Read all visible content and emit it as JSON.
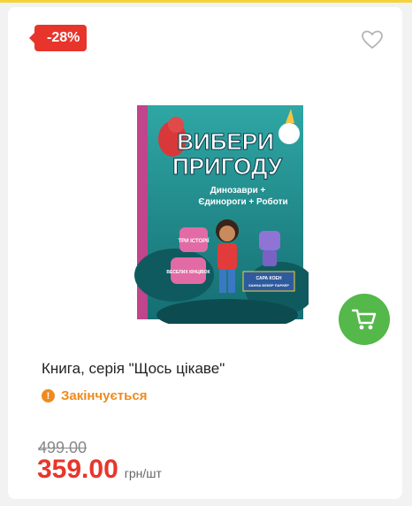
{
  "badge": {
    "discount": "-28%"
  },
  "product": {
    "title": "Книга, серія \"Щось цікаве\"",
    "status": "Закінчується",
    "old_price": "499.00",
    "price": "359.00",
    "unit": "грн/шт"
  },
  "cover": {
    "title_line1": "ВИБЕРИ",
    "title_line2": "ПРИГОДУ",
    "subtitle_line1": "Динозаври +",
    "subtitle_line2": "Єдинороги + Роботи",
    "bubble_top": "ТРИ ІСТОРІЇ",
    "bubble_bottom": "ВЕСЕЛИХ КІНЦІВОК",
    "authors_line1": "САРА КОЕН",
    "authors_line2": "ХАННА БЕКЕР ПАРКЕР"
  },
  "icons": {
    "favorite": "heart-icon",
    "cart": "cart-icon",
    "status": "alert-icon"
  },
  "colors": {
    "discount": "#e8352b",
    "cart": "#54b84a",
    "status": "#f08a1e",
    "price": "#e8352b"
  }
}
